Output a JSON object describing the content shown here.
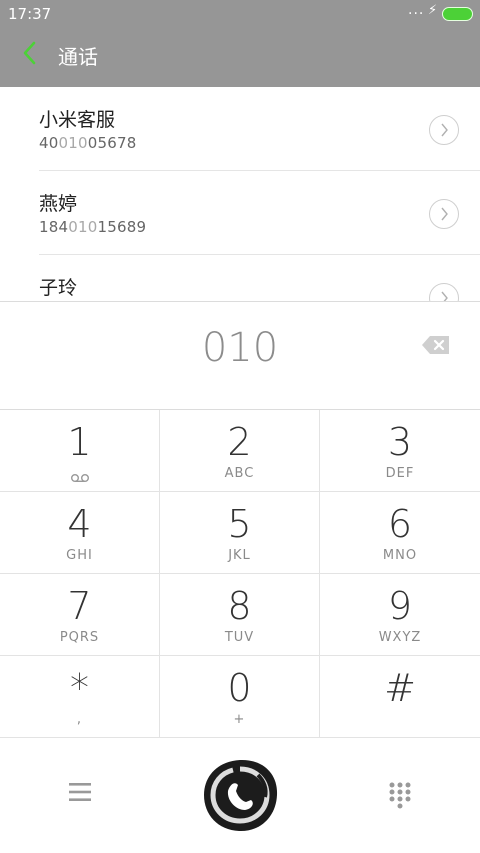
{
  "status_bar": {
    "time": "17:37",
    "signal": "...",
    "bolt": "⚡"
  },
  "title_bar": {
    "back_icon": "chevron-left-icon",
    "title": "通话"
  },
  "results": [
    {
      "name": "小米客服",
      "number_pre": "40",
      "number_match": "010",
      "number_post": "05678"
    },
    {
      "name": "燕婷",
      "number_pre": "184",
      "number_match": "010",
      "number_post": "15689"
    },
    {
      "name": "子玲",
      "number_pre": "",
      "number_match": "",
      "number_post": ""
    }
  ],
  "display": {
    "digits": "010",
    "backspace_icon": "backspace-icon"
  },
  "keys": [
    {
      "digit": "1",
      "letters": ""
    },
    {
      "digit": "2",
      "letters": "ABC"
    },
    {
      "digit": "3",
      "letters": "DEF"
    },
    {
      "digit": "4",
      "letters": "GHI"
    },
    {
      "digit": "5",
      "letters": "JKL"
    },
    {
      "digit": "6",
      "letters": "MNO"
    },
    {
      "digit": "7",
      "letters": "PQRS"
    },
    {
      "digit": "8",
      "letters": "TUV"
    },
    {
      "digit": "9",
      "letters": "WXYZ"
    },
    {
      "digit": "*",
      "letters": ","
    },
    {
      "digit": "0",
      "letters": "+"
    },
    {
      "digit": "#",
      "letters": ""
    }
  ],
  "actions": {
    "menu_icon": "menu-icon",
    "call_icon": "call-icon",
    "dialpad_icon": "dialpad-icon"
  },
  "colors": {
    "accent_green": "#4cd137",
    "header_gray": "#969696"
  }
}
